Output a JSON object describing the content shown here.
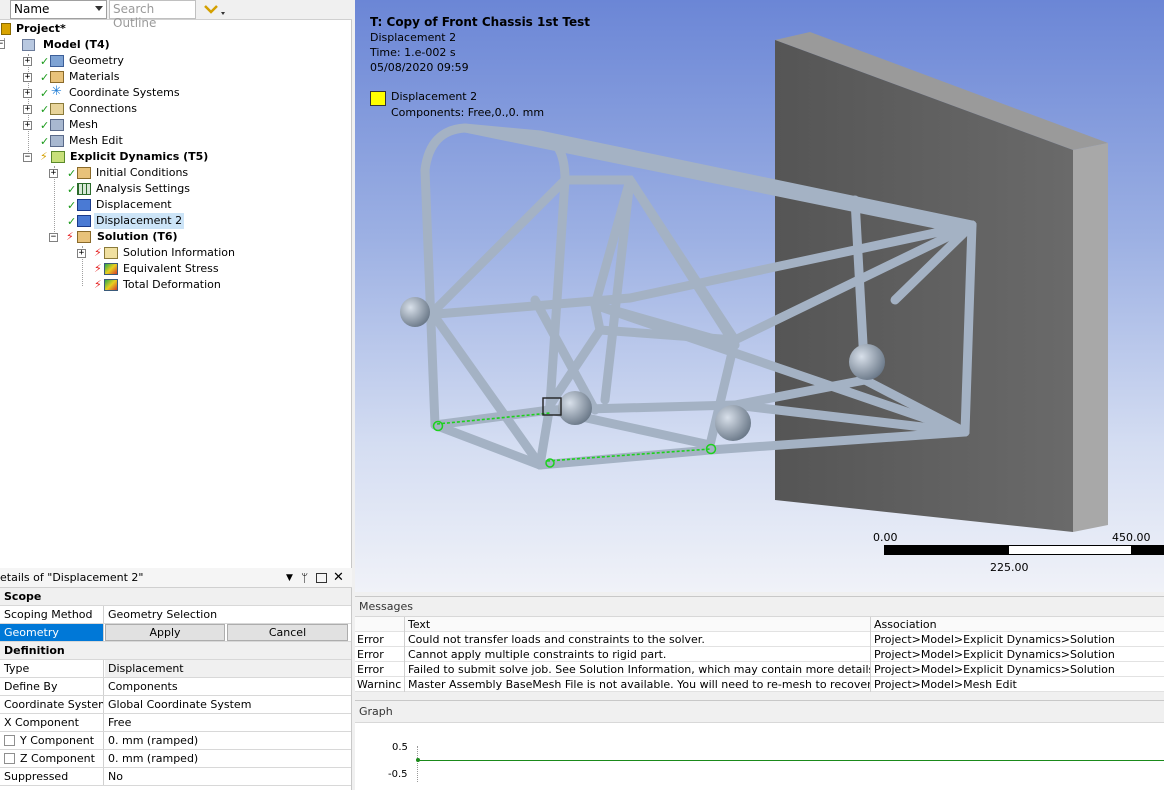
{
  "outline": {
    "toolbar": {
      "name_select": "Name",
      "search_placeholder": "Search Outline"
    },
    "tree": [
      {
        "label": "Project*",
        "bold": true,
        "icon": "project-icon"
      },
      {
        "label": "Model (T4)",
        "bold": true,
        "icon": "model-icon"
      },
      {
        "label": "Geometry",
        "icon": "geometry-icon",
        "status": "check"
      },
      {
        "label": "Materials",
        "icon": "materials-icon",
        "status": "check"
      },
      {
        "label": "Coordinate Systems",
        "icon": "coordinate-systems-icon",
        "status": "check"
      },
      {
        "label": "Connections",
        "icon": "connections-icon",
        "status": "check"
      },
      {
        "label": "Mesh",
        "icon": "mesh-icon",
        "status": "check"
      },
      {
        "label": "Mesh Edit",
        "icon": "mesh-edit-icon",
        "status": "check"
      },
      {
        "label": "Explicit Dynamics (T5)",
        "bold": true,
        "icon": "explicit-dynamics-icon",
        "status": "lightning"
      },
      {
        "label": "Initial Conditions",
        "icon": "initial-conditions-icon",
        "status": "check"
      },
      {
        "label": "Analysis Settings",
        "icon": "analysis-settings-icon",
        "status": "check"
      },
      {
        "label": "Displacement",
        "icon": "displacement-icon",
        "status": "check"
      },
      {
        "label": "Displacement 2",
        "icon": "displacement-icon",
        "status": "check",
        "selected": true
      },
      {
        "label": "Solution (T6)",
        "bold": true,
        "icon": "solution-icon",
        "status": "lightning"
      },
      {
        "label": "Solution Information",
        "icon": "solution-information-icon",
        "status": "lightning"
      },
      {
        "label": "Equivalent Stress",
        "icon": "equivalent-stress-icon",
        "status": "lightning"
      },
      {
        "label": "Total Deformation",
        "icon": "total-deformation-icon",
        "status": "lightning"
      }
    ]
  },
  "details": {
    "title": "etails of \"Displacement 2\"",
    "scope_category": "Scope",
    "scoping_method_label": "Scoping Method",
    "scoping_method_value": "Geometry Selection",
    "geometry_label": "Geometry",
    "apply_button": "Apply",
    "cancel_button": "Cancel",
    "definition_category": "Definition",
    "rows": [
      {
        "key": "Type",
        "value": "Displacement"
      },
      {
        "key": "Define By",
        "value": "Components"
      },
      {
        "key": "Coordinate System",
        "value": "Global Coordinate System"
      },
      {
        "key": "X Component",
        "value": "Free"
      },
      {
        "key": "Y Component",
        "value": "0. mm  (ramped)",
        "checkbox": true
      },
      {
        "key": "Z Component",
        "value": "0. mm  (ramped)",
        "checkbox": true
      },
      {
        "key": "Suppressed",
        "value": "No"
      }
    ]
  },
  "viewport": {
    "title": "T: Copy of Front Chassis 1st Test",
    "line2": "Displacement 2",
    "line3": "Time: 1.e-002 s",
    "line4": "05/08/2020 09:59",
    "legend_label": "Displacement 2",
    "legend_detail": "Components: Free,0.,0. mm",
    "legend_color": "#ffff00",
    "scale_left": "0.00",
    "scale_right": "450.00",
    "scale_mid": "225.00"
  },
  "messages": {
    "title": "Messages",
    "col_text": "Text",
    "col_association": "Association",
    "rows": [
      {
        "type": "Error",
        "text": "Could not transfer loads and constraints to the solver.",
        "assoc": "Project>Model>Explicit Dynamics>Solution"
      },
      {
        "type": "Error",
        "text": "Cannot apply multiple constraints to rigid part.",
        "assoc": "Project>Model>Explicit Dynamics>Solution"
      },
      {
        "type": "Error",
        "text": "Failed to submit solve job. See Solution Information, which may contain more details.",
        "assoc": "Project>Model>Explicit Dynamics>Solution"
      },
      {
        "type": "Warninc",
        "text": "Master Assembly BaseMesh File is not available. You will need to re-mesh to recover the fil",
        "assoc": "Project>Model>Mesh Edit"
      }
    ]
  },
  "graph": {
    "title": "Graph",
    "y_top": "0.5",
    "y_bottom": "-0.5",
    "line_color": "#1a8a1a"
  },
  "colors": {
    "selection": "#0078d7",
    "tree_selected": "#cce4f7",
    "tube": "#9aa8b8",
    "wall": "#5a5a5a"
  }
}
